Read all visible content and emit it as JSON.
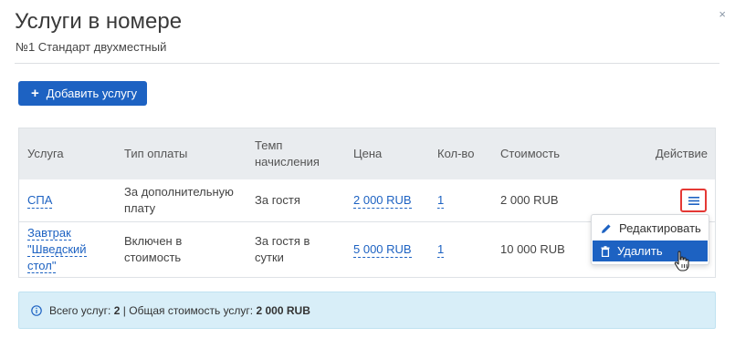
{
  "modal": {
    "title": "Услуги в номере",
    "subtitle": "№1 Стандарт двухместный",
    "close_glyph": "×"
  },
  "toolbar": {
    "add_label": "Добавить услугу"
  },
  "table": {
    "headers": {
      "service": "Услуга",
      "payment_type": "Тип оплаты",
      "accrual_1": "Темп",
      "accrual_2": "начисления",
      "price": "Цена",
      "qty": "Кол-во",
      "cost": "Стоимость",
      "action": "Действие"
    },
    "rows": [
      {
        "service_lines": [
          "СПА"
        ],
        "payment_lines": [
          "За дополнительную",
          "плату"
        ],
        "accrual_lines": [
          "За гостя"
        ],
        "price": "2 000 RUB",
        "qty": "1",
        "cost": "2 000 RUB"
      },
      {
        "service_lines": [
          "Завтрак",
          "\"Шведский",
          "стол\""
        ],
        "payment_lines": [
          "Включен в",
          "стоимость"
        ],
        "accrual_lines": [
          "За гостя в",
          "сутки"
        ],
        "price": "5 000 RUB",
        "qty": "1",
        "cost": "10 000 RUB"
      }
    ]
  },
  "dropdown": {
    "items": [
      {
        "label": "Редактировать",
        "icon": "pencil-icon"
      },
      {
        "label": "Удалить",
        "icon": "trash-icon"
      }
    ],
    "active_index": 1
  },
  "summary": {
    "total_label": "Всего услуг:",
    "total_value": "2",
    "separator": "|",
    "cost_label": "Общая стоимость услуг:",
    "cost_value": "2 000 RUB",
    "icon": "info-icon"
  },
  "colors": {
    "accent": "#1d62c2",
    "highlight_border": "#e53935",
    "info_bg": "#d8eef8"
  }
}
